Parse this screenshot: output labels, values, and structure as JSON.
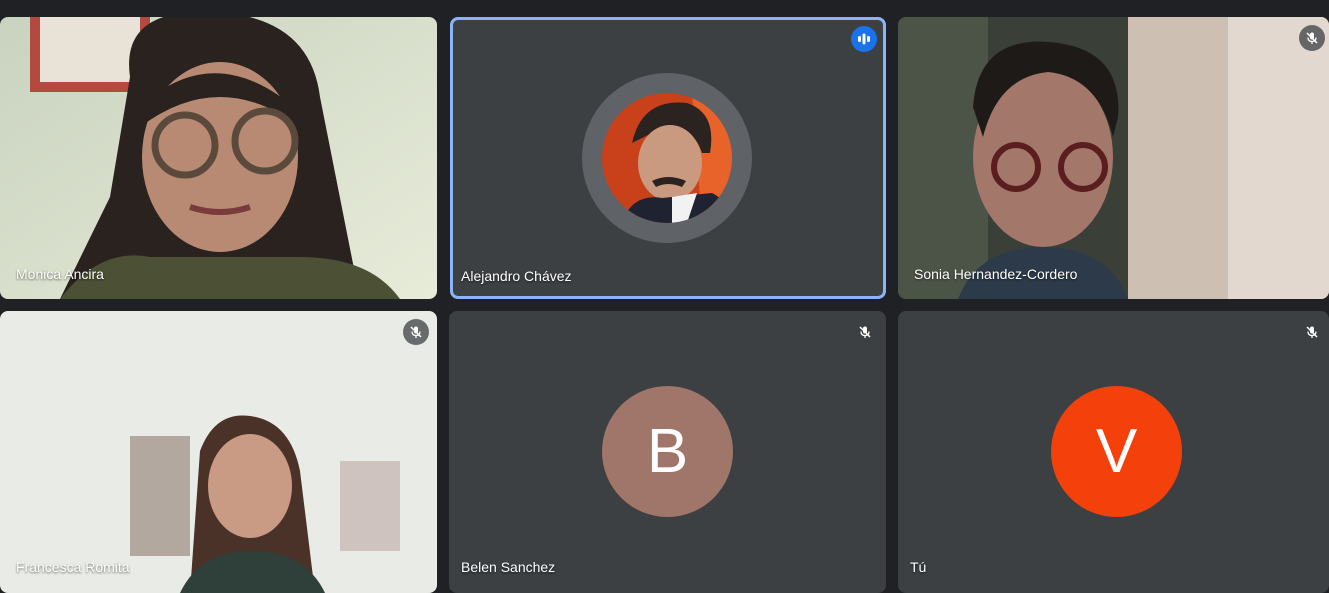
{
  "participants": [
    {
      "name": "Monica Ancira",
      "video": true,
      "muted": false
    },
    {
      "name": "Alejandro Chávez",
      "video": false,
      "speaking": true,
      "muted": false
    },
    {
      "name": "Sonia Hernandez-Cordero",
      "video": true,
      "muted": true
    },
    {
      "name": "Francesca Romita",
      "video": true,
      "muted": true
    },
    {
      "name": "Belen Sanchez",
      "video": false,
      "initial": "B",
      "avatar_color": "#a1766a",
      "muted": true
    },
    {
      "name": "Tú",
      "video": false,
      "initial": "V",
      "avatar_color": "#f4400b",
      "muted": true
    }
  ],
  "colors": {
    "speaking_border": "#8ab4f8",
    "speaking_badge": "#1a73e8",
    "tile_bg": "#3c4043",
    "page_bg": "#202124"
  },
  "icons": {
    "mic_off": "mic-off-icon",
    "speaking": "audio-level-icon"
  }
}
